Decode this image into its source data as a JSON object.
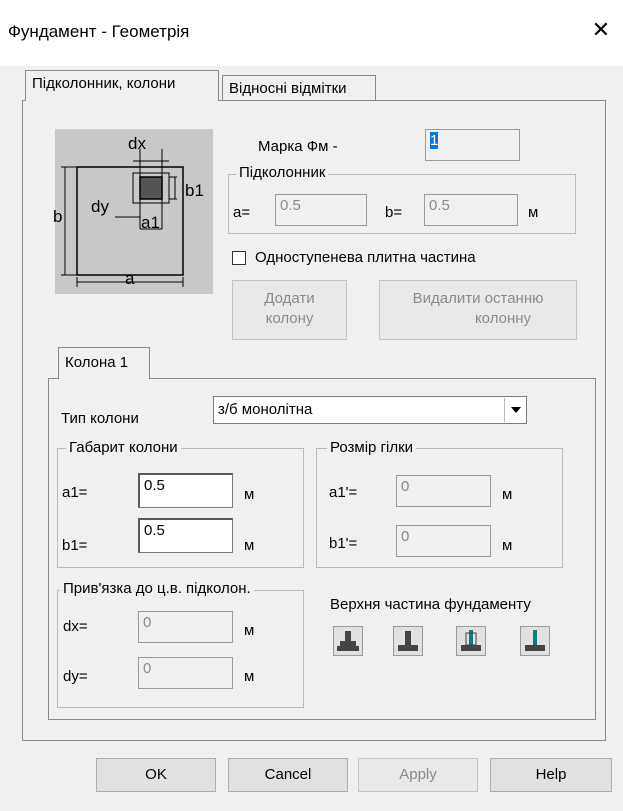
{
  "window": {
    "title": "Фундамент - Геометрія",
    "close": "✕"
  },
  "tabs": [
    "Підколонник, колони",
    "Відносні відмітки"
  ],
  "diagram": {
    "dx": "dx",
    "dy": "dy",
    "b": "b",
    "b1": "b1",
    "a1": "a1",
    "a": "a"
  },
  "marka": {
    "label": "Марка  Фм -",
    "value": "1"
  },
  "podkolonnik": {
    "legend": "Підколонник",
    "a_label": "a=",
    "a_value": "0.5",
    "b_label": "b=",
    "b_value": "0.5",
    "unit": "м"
  },
  "checkbox": {
    "label": "Одноступенева плитна частина",
    "checked": false
  },
  "buttons": {
    "add_line1": "Додати",
    "add_line2": "колону",
    "remove_line1": "Видалити останню",
    "remove_line2": "колонну"
  },
  "inner_tab": "Колона 1",
  "column_type": {
    "label": "Тип колони",
    "value": "з/б монолітна"
  },
  "gabarit": {
    "legend": "Габарит колони",
    "a1_label": "a1=",
    "a1_value": "0.5",
    "b1_label": "b1=",
    "b1_value": "0.5",
    "unit": "м"
  },
  "branch": {
    "legend": "Розмір гілки",
    "a1_label": "a1'=",
    "a1_value": "0",
    "b1_label": "b1'=",
    "b1_value": "0",
    "unit": "м"
  },
  "binding": {
    "legend": "Прив'язка до ц.в. підколон.",
    "dx_label": "dx=",
    "dx_value": "0",
    "dy_label": "dy=",
    "dy_value": "0",
    "unit": "м"
  },
  "top_part": {
    "label": "Верхня частина фундаменту"
  },
  "footer": {
    "ok": "OK",
    "cancel": "Cancel",
    "apply": "Apply",
    "help": "Help"
  }
}
